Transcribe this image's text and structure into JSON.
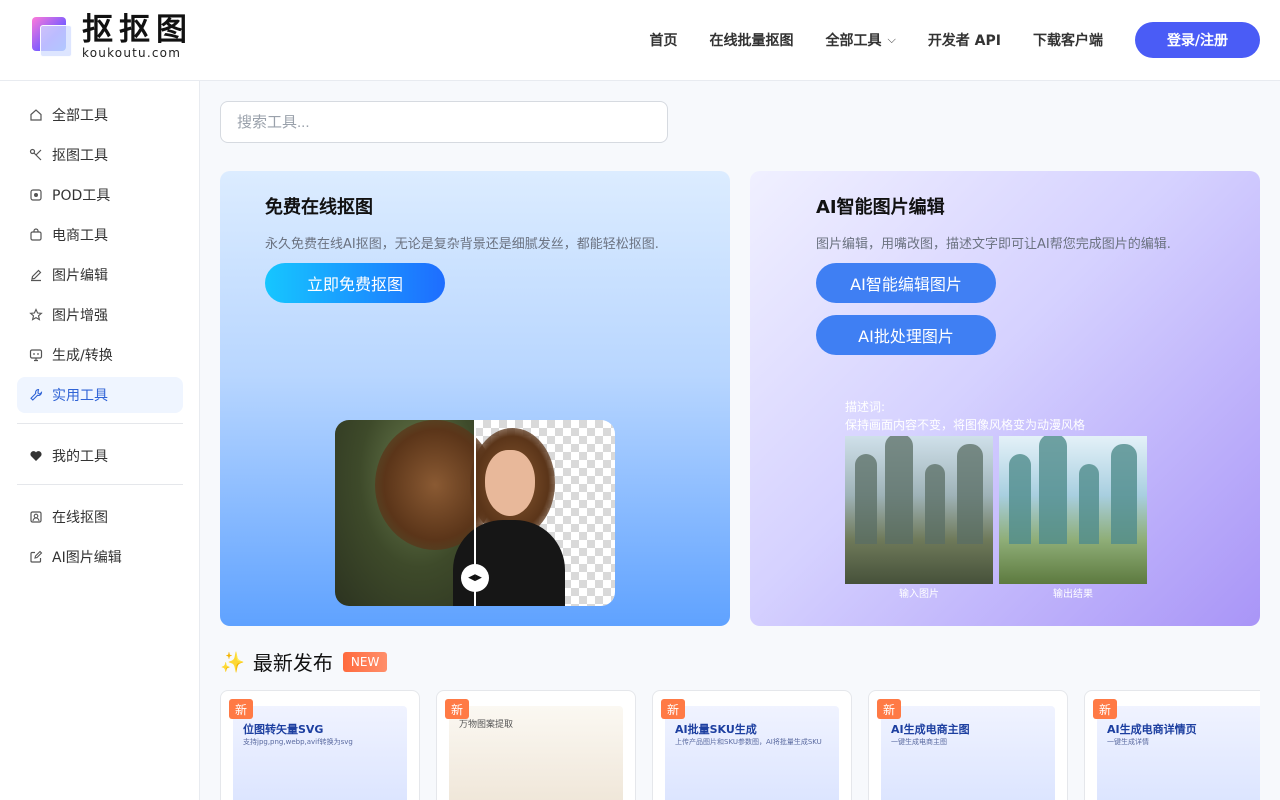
{
  "header": {
    "logo_cn": "抠抠图",
    "logo_en": "koukoutu.com",
    "nav": [
      {
        "label": "首页"
      },
      {
        "label": "在线批量抠图"
      },
      {
        "label": "全部工具"
      },
      {
        "label": "开发者 API"
      },
      {
        "label": "下载客户端"
      }
    ],
    "login_label": "登录/注册"
  },
  "sidebar": {
    "items": [
      {
        "label": "全部工具",
        "icon": "home-icon"
      },
      {
        "label": "抠图工具",
        "icon": "scissors-icon"
      },
      {
        "label": "POD工具",
        "icon": "shirt-icon"
      },
      {
        "label": "电商工具",
        "icon": "shopping-bag-icon"
      },
      {
        "label": "图片编辑",
        "icon": "pencil-icon"
      },
      {
        "label": "图片增强",
        "icon": "star-icon"
      },
      {
        "label": "生成/转换",
        "icon": "monitor-icon"
      },
      {
        "label": "实用工具",
        "icon": "wrench-icon",
        "active": true
      }
    ],
    "mine": {
      "label": "我的工具",
      "icon": "heart-icon"
    },
    "links": [
      {
        "label": "在线抠图",
        "icon": "portrait-icon"
      },
      {
        "label": "AI图片编辑",
        "icon": "edit-square-icon"
      }
    ],
    "active_color": "#2f63d6"
  },
  "search": {
    "placeholder": "搜索工具..."
  },
  "cards": {
    "left": {
      "title": "免费在线抠图",
      "desc": "永久免费在线AI抠图，无论是复杂背景还是细腻发丝，都能轻松抠图.",
      "button": "立即免费抠图"
    },
    "right": {
      "title": "AI智能图片编辑",
      "desc": "图片编辑，用嘴改图，描述文字即可让AI帮您完成图片的编辑.",
      "button1": "AI智能编辑图片",
      "button2": "AI批处理图片",
      "prompt_title": "描述词:",
      "prompt_text": "保持画面内容不变，将图像风格变为动漫风格",
      "caption_in": "输入图片",
      "caption_out": "输出结果"
    }
  },
  "latest": {
    "title": "最新发布",
    "badge": "NEW",
    "tiles": [
      {
        "badge": "新",
        "title": "位图转矢量SVG",
        "sub": "支持jpg,png,webp,avif转换为svg"
      },
      {
        "badge": "新",
        "title": "万物图案提取",
        "sub": ""
      },
      {
        "badge": "新",
        "title": "AI批量SKU生成",
        "sub": "上传产品图片和SKU参数图，AI将批量生成SKU"
      },
      {
        "badge": "新",
        "title": "AI生成电商主图",
        "sub": "一键生成电商主图"
      },
      {
        "badge": "新",
        "title": "AI生成电商详情页",
        "sub": "一键生成详情"
      }
    ]
  },
  "colors": {
    "primary": "#4a5cf6",
    "badge": "#ff7a45"
  }
}
